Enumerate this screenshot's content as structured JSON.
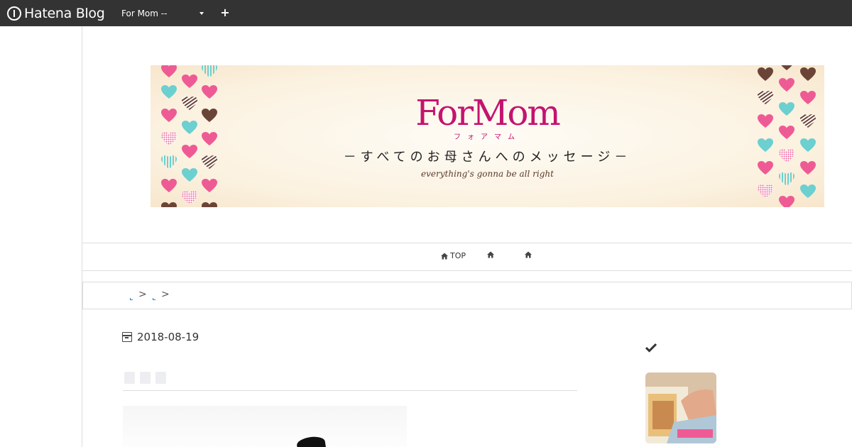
{
  "topbar": {
    "logo_text": "Hatena Blog",
    "blog_selector": "For Mom --",
    "plus_label": "+"
  },
  "banner": {
    "title": "ForMom",
    "kana": "フォアマム",
    "subtitle": "－すべてのお母さんへのメッセージ－",
    "tagline": "everything's gonna be all right",
    "colors": {
      "pink": "#ee5b94",
      "teal": "#6ccfd0",
      "brown": "#6b4438",
      "title": "#c4136f"
    }
  },
  "nav": {
    "items": [
      {
        "icon": "home-icon",
        "label": "TOP"
      },
      {
        "icon": "home-icon",
        "label": ""
      },
      {
        "icon": "home-icon",
        "label": ""
      }
    ]
  },
  "breadcrumb": {
    "separators": [
      ">",
      ">"
    ]
  },
  "article": {
    "date": "2018-08-19",
    "title_placeholder_count": 3
  },
  "sidebar": {
    "check_icon": "check-icon"
  }
}
